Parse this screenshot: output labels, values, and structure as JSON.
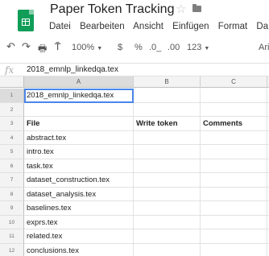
{
  "app": {
    "title": "Paper Token Tracking",
    "icons": {
      "app": "sheets-icon",
      "star": "star-icon",
      "folder": "folder-icon"
    }
  },
  "menu": [
    "Datei",
    "Bearbeiten",
    "Ansicht",
    "Einfügen",
    "Format",
    "Da"
  ],
  "toolbar": {
    "zoom": "100%",
    "currency": "$",
    "percent": "%",
    "decrease_decimals": ".0_",
    "increase_decimals": ".00",
    "number_format": "123",
    "font_partial": "Ari"
  },
  "formula_bar": {
    "fx_label": "fx",
    "value": "2018_emnlp_linkedqa.tex"
  },
  "sheet": {
    "columns": [
      "A",
      "B",
      "C"
    ],
    "rows": [
      {
        "num": "1",
        "a": "2018_emnlp_linkedqa.tex",
        "b": "",
        "c": ""
      },
      {
        "num": "2",
        "a": "",
        "b": "",
        "c": ""
      },
      {
        "num": "3",
        "a": "File",
        "b": "Write token",
        "c": "Comments"
      },
      {
        "num": "4",
        "a": "abstract.tex",
        "b": "",
        "c": ""
      },
      {
        "num": "5",
        "a": "intro.tex",
        "b": "",
        "c": ""
      },
      {
        "num": "6",
        "a": "task.tex",
        "b": "",
        "c": ""
      },
      {
        "num": "7",
        "a": "dataset_construction.tex",
        "b": "",
        "c": ""
      },
      {
        "num": "8",
        "a": "dataset_analysis.tex",
        "b": "",
        "c": ""
      },
      {
        "num": "9",
        "a": "baselines.tex",
        "b": "",
        "c": ""
      },
      {
        "num": "10",
        "a": "exprs.tex",
        "b": "",
        "c": ""
      },
      {
        "num": "11",
        "a": "related.tex",
        "b": "",
        "c": ""
      },
      {
        "num": "12",
        "a": "conclusions.tex",
        "b": "",
        "c": ""
      }
    ]
  },
  "colors": {
    "accent": "#0f9d58",
    "selection": "#4a86e8"
  }
}
